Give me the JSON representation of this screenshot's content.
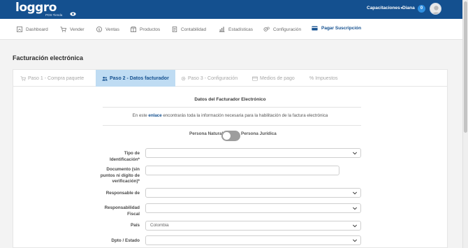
{
  "header": {
    "logo_text": "loggro",
    "logo_subtitle": "POS Tienda",
    "menu_capacitaciones": "Capacitaciones",
    "user_name": "Diana",
    "notifications_count": "0"
  },
  "nav": {
    "items": [
      {
        "label": "Dashboard",
        "icon": "dashboard-icon"
      },
      {
        "label": "Vender",
        "icon": "cart-icon"
      },
      {
        "label": "Ventas",
        "icon": "dollar-icon"
      },
      {
        "label": "Productos",
        "icon": "box-icon"
      },
      {
        "label": "Contabilidad",
        "icon": "ledger-icon"
      },
      {
        "label": "Estadísticas",
        "icon": "chart-icon"
      },
      {
        "label": "Configuración",
        "icon": "gears-icon"
      }
    ],
    "pay_label": "Pagar Suscripción"
  },
  "page": {
    "title": "Facturación electrónica"
  },
  "tabs": [
    {
      "label": "Paso 1 - Compra paquete",
      "active": false
    },
    {
      "label": "Paso 2 - Datos facturador",
      "active": true
    },
    {
      "label": "Paso 3 - Configuración",
      "active": false
    },
    {
      "label": "Medios de pago",
      "active": false
    },
    {
      "label": "Impuestos",
      "active": false
    }
  ],
  "form": {
    "section_title": "Datos del Facturador Electrónico",
    "info_prefix": "En este",
    "info_link": "enlace",
    "info_suffix": "encontrarás toda la información necesaria para la habilitación de la factura electrónica",
    "toggle_left": "Persona Natural",
    "toggle_right": "Persona Jurídica",
    "toggle_on": false,
    "fields": [
      {
        "label": "Tipo de Identificación*",
        "value": ""
      },
      {
        "label": "Documento (sin puntos ni dígito de verificación)*",
        "value": ""
      },
      {
        "label": "Responsable de",
        "value": ""
      },
      {
        "label": "Responsabilidad Fiscal",
        "value": ""
      },
      {
        "label": "País",
        "value": "Colombia"
      },
      {
        "label": "Dpto / Estado",
        "value": ""
      }
    ]
  },
  "colors": {
    "topbar": "#14508f",
    "accent": "#14508f",
    "active_tab": "#bfdcf3"
  }
}
